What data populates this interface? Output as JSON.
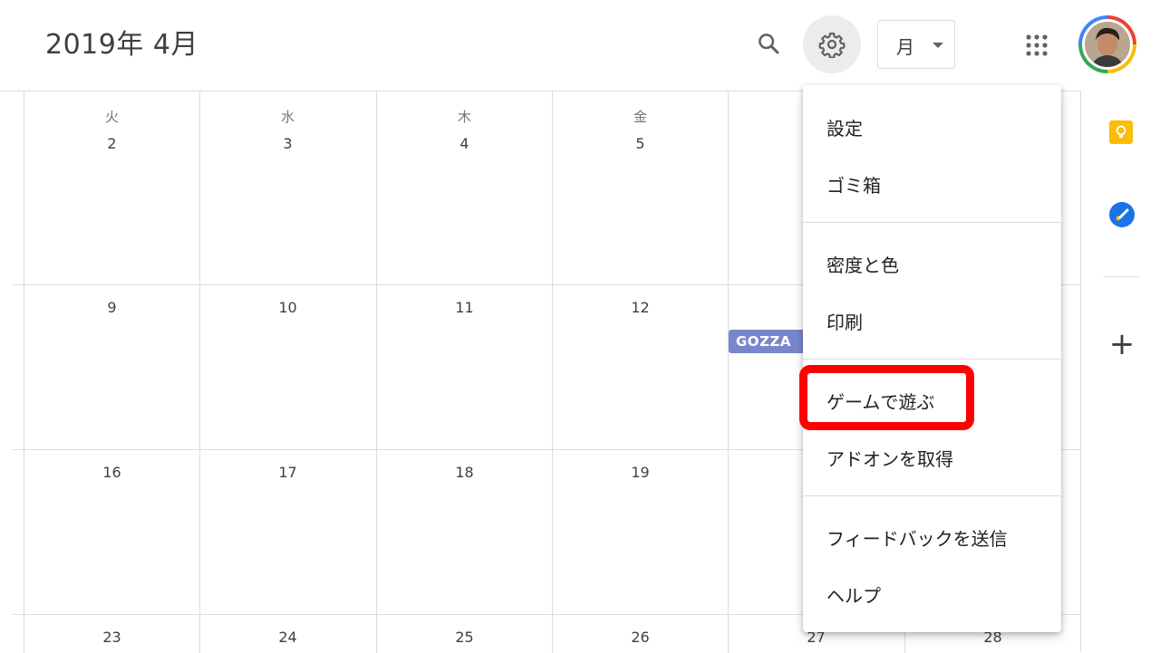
{
  "header": {
    "title": "2019年 4月",
    "view_selector": "月"
  },
  "calendar": {
    "weekday_headers": [
      "火",
      "水",
      "木",
      "金"
    ],
    "weeks": [
      [
        "2",
        "3",
        "4",
        "5"
      ],
      [
        "9",
        "10",
        "11",
        "12"
      ],
      [
        "16",
        "17",
        "18",
        "19"
      ],
      [
        "23",
        "24",
        "25",
        "26",
        "27",
        "28"
      ]
    ],
    "event": {
      "label": "GOZZA",
      "color": "#7986cb"
    }
  },
  "settings_menu": {
    "items": [
      "設定",
      "ゴミ箱",
      "密度と色",
      "印刷",
      "ゲームで遊ぶ",
      "アドオンを取得",
      "フィードバックを送信",
      "ヘルプ"
    ],
    "highlighted_item": "ゲームで遊ぶ",
    "highlight_color": "#ff0000"
  },
  "side_panel": {
    "icons": [
      "keep-icon",
      "tasks-icon",
      "add-icon"
    ],
    "add_label": "+"
  },
  "colors": {
    "keep": "#fbbc04",
    "tasks": "#1a73e8",
    "avatar_ring": [
      "#ea4335",
      "#fbbc04",
      "#34a853",
      "#4285f4"
    ]
  }
}
